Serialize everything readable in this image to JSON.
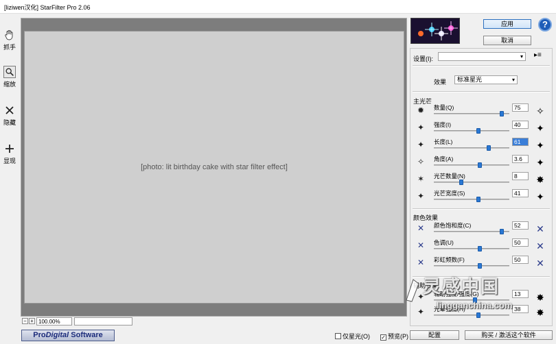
{
  "window": {
    "title": "[liziwen汉化] StarFilter Pro 2.06"
  },
  "toolbar": {
    "tools": [
      {
        "label": "抓手",
        "icon": "hand-icon"
      },
      {
        "label": "缩放",
        "icon": "magnifier-icon"
      },
      {
        "label": "隐藏",
        "icon": "x-icon"
      },
      {
        "label": "显现",
        "icon": "plus-icon"
      }
    ]
  },
  "canvas": {
    "placeholder": "[photo: lit birthday cake with star filter effect]"
  },
  "zoom": {
    "minus": "−",
    "plus": "+",
    "value": "100.00%"
  },
  "brand": {
    "text_a": "Pro",
    "text_b": "Digital",
    "text_c": " Software"
  },
  "bottom": {
    "only_stars_label": "仅星光(O)",
    "only_stars_checked": false,
    "preview_label": "预览(P)",
    "preview_checked": true,
    "configure_label": "配置",
    "buy_label": "购买 / 激活这个软件"
  },
  "actions": {
    "apply_label": "应用",
    "cancel_label": "取消",
    "help_label": "?"
  },
  "panel": {
    "settings_label": "设置(I):",
    "settings_value": "",
    "effect_label": "效果",
    "effect_value": "标准星光",
    "main_section": "主光芒",
    "color_section": "颜色效果",
    "aux_section": "辅助效果",
    "main_params": [
      {
        "label": "数量(Q)",
        "value": "75",
        "pos": 0.92
      },
      {
        "label": "强度(I)",
        "value": "40",
        "pos": 0.6
      },
      {
        "label": "长度(L)",
        "value": "61",
        "pos": 0.74,
        "highlight": true
      },
      {
        "label": "角度(A)",
        "value": "3.6",
        "pos": 0.62
      },
      {
        "label": "光芒数量(N)",
        "value": "8",
        "pos": 0.36
      },
      {
        "label": "光芒宽度(S)",
        "value": "41",
        "pos": 0.6
      }
    ],
    "color_params": [
      {
        "label": "颜色饱和度(C)",
        "value": "52",
        "pos": 0.92
      },
      {
        "label": "色调(U)",
        "value": "50",
        "pos": 0.62
      },
      {
        "label": "彩虹频数(F)",
        "value": "50",
        "pos": 0.62
      }
    ],
    "aux_params": [
      {
        "label": "辅助强度/强度(G)",
        "value": "13",
        "pos": 0.55
      },
      {
        "label": "光晕强度(H)",
        "value": "38",
        "pos": 0.6
      }
    ]
  },
  "watermark": {
    "cn": "灵感中国",
    "en": "lingganchina.com"
  },
  "colors": {
    "accent": "#2a78d4",
    "help": "#1e5db8",
    "brand": "#1a2a7a"
  }
}
